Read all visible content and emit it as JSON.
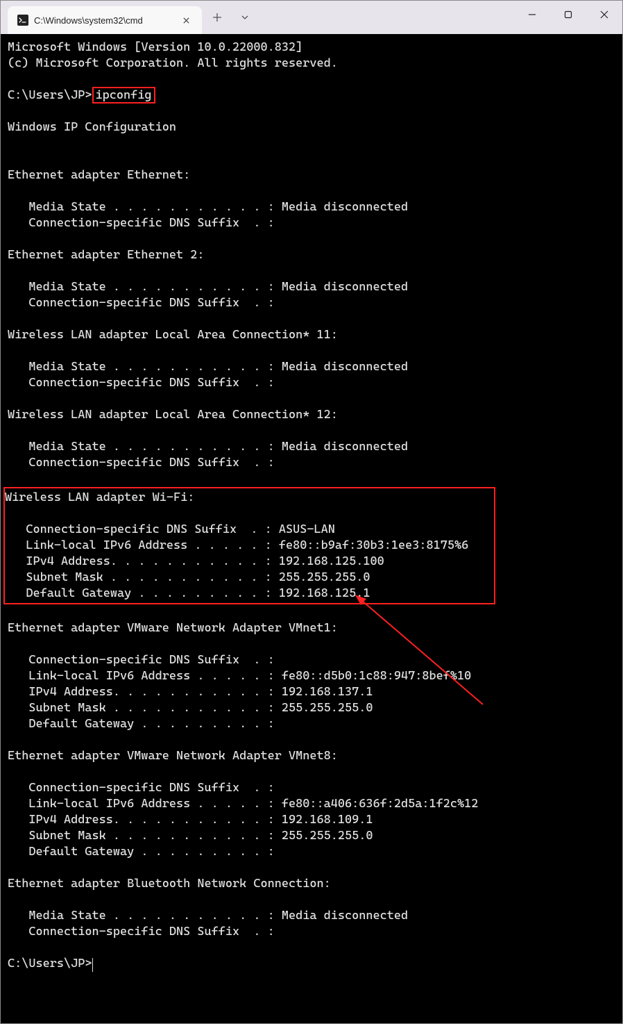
{
  "titlebar": {
    "tab_title": "C:\\Windows\\system32\\cmd"
  },
  "terminal": {
    "header_line1": "Microsoft Windows [Version 10.0.22000.832]",
    "header_line2": "(c) Microsoft Corporation. All rights reserved.",
    "prompt1": "C:\\Users\\JP>",
    "command": "ipconfig",
    "config_heading": "Windows IP Configuration",
    "adapters": [
      {
        "name": "Ethernet adapter Ethernet:",
        "lines": [
          "   Media State . . . . . . . . . . . : Media disconnected",
          "   Connection-specific DNS Suffix  . :"
        ]
      },
      {
        "name": "Ethernet adapter Ethernet 2:",
        "lines": [
          "   Media State . . . . . . . . . . . : Media disconnected",
          "   Connection-specific DNS Suffix  . :"
        ]
      },
      {
        "name": "Wireless LAN adapter Local Area Connection* 11:",
        "lines": [
          "   Media State . . . . . . . . . . . : Media disconnected",
          "   Connection-specific DNS Suffix  . :"
        ]
      },
      {
        "name": "Wireless LAN adapter Local Area Connection* 12:",
        "lines": [
          "   Media State . . . . . . . . . . . : Media disconnected",
          "   Connection-specific DNS Suffix  . :"
        ]
      },
      {
        "name": "Wireless LAN adapter Wi-Fi:",
        "highlighted": true,
        "lines": [
          "   Connection-specific DNS Suffix  . : ASUS-LAN",
          "   Link-local IPv6 Address . . . . . : fe80::b9af:30b3:1ee3:8175%6",
          "   IPv4 Address. . . . . . . . . . . : 192.168.125.100",
          "   Subnet Mask . . . . . . . . . . . : 255.255.255.0",
          "   Default Gateway . . . . . . . . . : 192.168.125.1"
        ]
      },
      {
        "name": "Ethernet adapter VMware Network Adapter VMnet1:",
        "lines": [
          "   Connection-specific DNS Suffix  . :",
          "   Link-local IPv6 Address . . . . . : fe80::d5b0:1c88:947:8bef%10",
          "   IPv4 Address. . . . . . . . . . . : 192.168.137.1",
          "   Subnet Mask . . . . . . . . . . . : 255.255.255.0",
          "   Default Gateway . . . . . . . . . :"
        ]
      },
      {
        "name": "Ethernet adapter VMware Network Adapter VMnet8:",
        "lines": [
          "   Connection-specific DNS Suffix  . :",
          "   Link-local IPv6 Address . . . . . : fe80::a406:636f:2d5a:1f2c%12",
          "   IPv4 Address. . . . . . . . . . . : 192.168.109.1",
          "   Subnet Mask . . . . . . . . . . . : 255.255.255.0",
          "   Default Gateway . . . . . . . . . :"
        ]
      },
      {
        "name": "Ethernet adapter Bluetooth Network Connection:",
        "lines": [
          "   Media State . . . . . . . . . . . : Media disconnected",
          "   Connection-specific DNS Suffix  . :"
        ]
      }
    ],
    "prompt2": "C:\\Users\\JP>"
  }
}
